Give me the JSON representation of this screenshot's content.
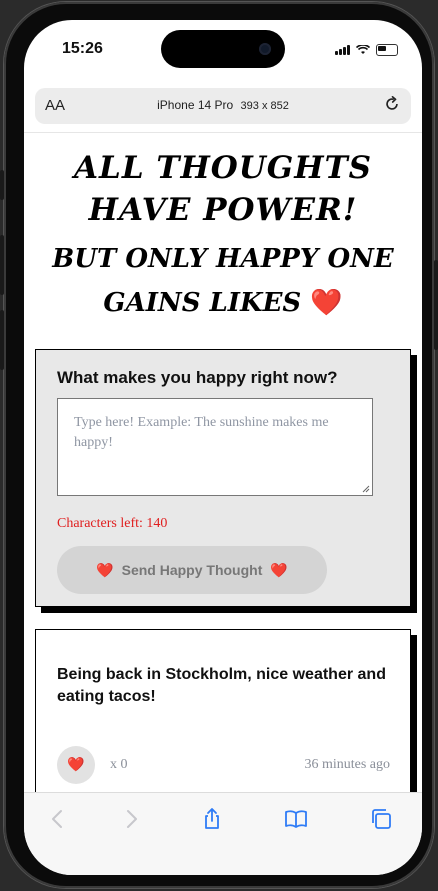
{
  "status_bar": {
    "time": "15:26"
  },
  "browser": {
    "text_size_label": "AA",
    "device_name": "iPhone 14 Pro",
    "device_dims": "393 x 852"
  },
  "page": {
    "headline": "All thoughts have power!",
    "subline": "But only happy one gains likes",
    "heart": "❤️"
  },
  "form": {
    "title": "What makes you happy right now?",
    "placeholder": "Type here! Example: The sunshine makes me happy!",
    "chars_left": "Characters left: 140",
    "send_label": "Send Happy Thought",
    "heart": "❤️"
  },
  "posts": [
    {
      "text": "Being back in Stockholm, nice weather and eating tacos!",
      "like_icon": "❤️",
      "likes": "x 0",
      "time_ago": "36 minutes ago"
    }
  ],
  "toolbar": {
    "icons": [
      "back-icon",
      "forward-icon",
      "share-icon",
      "bookmarks-icon",
      "tabs-icon"
    ]
  },
  "colors": {
    "accent_blue": "#2f7cf6",
    "heart_red": "#e0263a",
    "chars_left_red": "#e02020"
  }
}
